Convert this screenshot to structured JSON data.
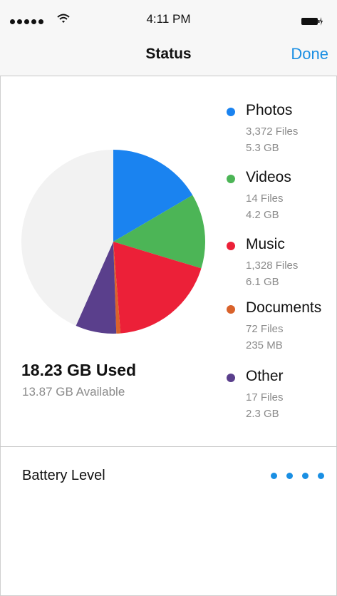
{
  "status_bar": {
    "time": "4:11 PM",
    "signal_icon": "signal-dots-icon",
    "wifi_icon": "wifi-icon",
    "battery_icon": "battery-charging-icon"
  },
  "nav": {
    "title": "Status",
    "done_label": "Done"
  },
  "storage": {
    "used_label": "18.23 GB Used",
    "available_label": "13.87 GB Available"
  },
  "legend": [
    {
      "label": "Photos",
      "files": "3,372 Files",
      "size": "5.3 GB",
      "color": "#1a83f0"
    },
    {
      "label": "Videos",
      "files": "14 Files",
      "size": "4.2 GB",
      "color": "#4cb556"
    },
    {
      "label": "Music",
      "files": "1,328 Files",
      "size": "6.1 GB",
      "color": "#ec2038"
    },
    {
      "label": "Documents",
      "files": "72 Files",
      "size": "235 MB",
      "color": "#d9622b"
    },
    {
      "label": "Other",
      "files": "17 Files",
      "size": "2.3 GB",
      "color": "#5a3f8c"
    }
  ],
  "pie_slices": [
    {
      "name": "Photos",
      "value": 5.3,
      "color": "#1a83f0"
    },
    {
      "name": "Videos",
      "value": 4.2,
      "color": "#4cb556"
    },
    {
      "name": "Music",
      "value": 6.1,
      "color": "#ec2038"
    },
    {
      "name": "Documents",
      "value": 0.235,
      "color": "#d9622b"
    },
    {
      "name": "Other",
      "value": 2.3,
      "color": "#5a3f8c"
    },
    {
      "name": "Available",
      "value": 13.87,
      "color": "#f2f2f2"
    }
  ],
  "battery": {
    "label": "Battery Level",
    "dots": 4,
    "dot_color": "#1a8fe3"
  }
}
